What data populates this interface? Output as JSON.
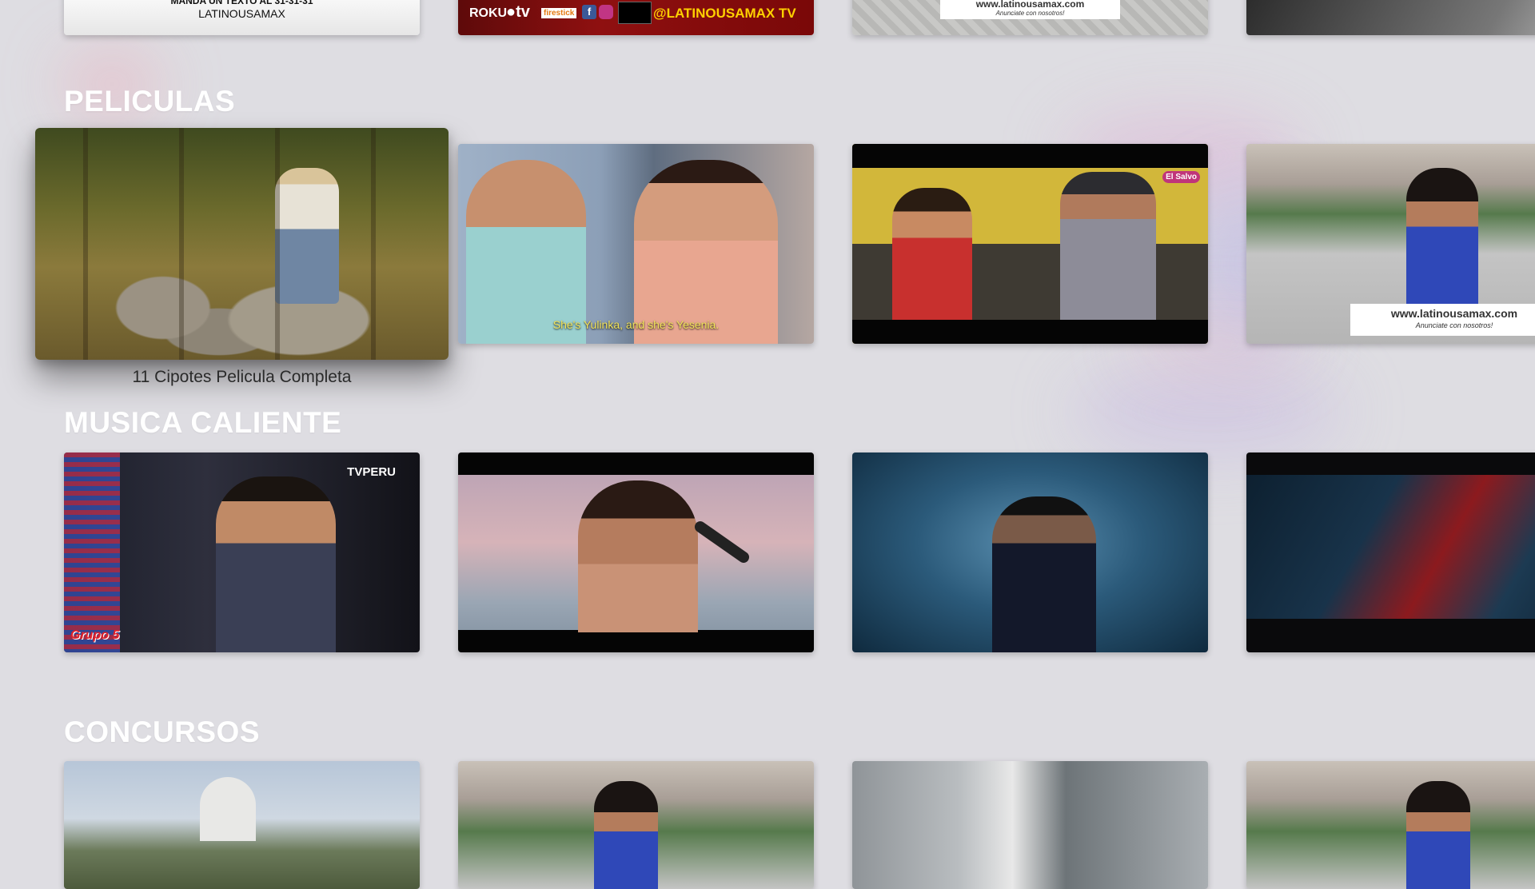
{
  "rows": {
    "top": {
      "tiles": [
        {
          "line1": "MANDA UN TEXTO AL 31-31-31",
          "line2": "LATINOUSAMAX"
        },
        {
          "brands": "ROKU",
          "apple_tv": "tv",
          "firestick": "firestick",
          "handle": "@LATINOUSAMAX TV"
        },
        {
          "url": "www.latinousamax.com",
          "tagline": "Anunciate con nosotros!"
        },
        {}
      ]
    },
    "peliculas": {
      "title": "PELICULAS",
      "focused_caption": "11 Cipotes Pelicula Completa",
      "tiles": [
        {},
        {
          "subtitle": "She's Yulinka, and she's Yesenia."
        },
        {
          "badge": "El Salvo"
        },
        {
          "url": "www.latinousamax.com",
          "tagline": "Anunciate con nosotros!"
        }
      ]
    },
    "musica": {
      "title": "MUSICA CALIENTE",
      "tiles": [
        {
          "channel_logo": "TVPERU",
          "band_logo": "Grupo 5"
        },
        {},
        {},
        {}
      ]
    },
    "concursos": {
      "title": "CONCURSOS",
      "tiles": [
        {},
        {},
        {},
        {}
      ]
    }
  }
}
